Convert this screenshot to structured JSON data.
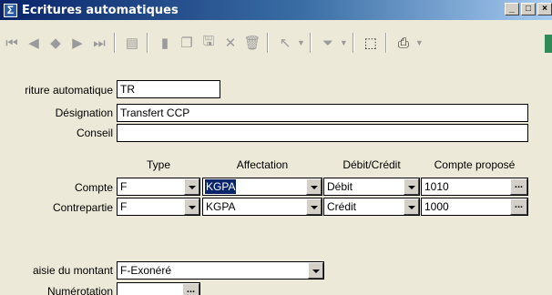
{
  "window": {
    "title": "Ecritures automatiques",
    "icon": "sigma-icon",
    "buttons": [
      "_",
      "□",
      "×"
    ]
  },
  "toolbar": {
    "icons": [
      "first-record-icon",
      "prev-record-icon",
      "diamond-icon",
      "next-record-icon",
      "last-record-icon",
      "table-view-icon",
      "new-record-icon",
      "copy-record-icon",
      "save-icon",
      "delete-icon",
      "trash-icon",
      "pointer-icon",
      "filter-icon",
      "cursor-select-icon",
      "print-icon",
      "exit-icon"
    ]
  },
  "form": {
    "ecriture_label": "riture automatique",
    "ecriture_value": "TR",
    "designation_label": "Désignation",
    "designation_value": "Transfert CCP",
    "conseil_label": "Conseil",
    "conseil_value": "",
    "columns": {
      "type": "Type",
      "affectation": "Affectation",
      "debit_credit": "Débit/Crédit",
      "compte_propose": "Compte proposé"
    },
    "compte": {
      "label": "Compte",
      "type": "F",
      "affectation": "KGPA",
      "debit_credit": "Débit",
      "compte_propose": "1010"
    },
    "contrepartie": {
      "label": "Contrepartie",
      "type": "F",
      "affectation": "KGPA",
      "debit_credit": "Crédit",
      "compte_propose": "1000"
    },
    "saisie_label": "aisie du montant",
    "saisie_value": "F-Exonéré",
    "numerotation_label": "Numérotation",
    "numerotation_value": "",
    "ellipsis": "..."
  }
}
